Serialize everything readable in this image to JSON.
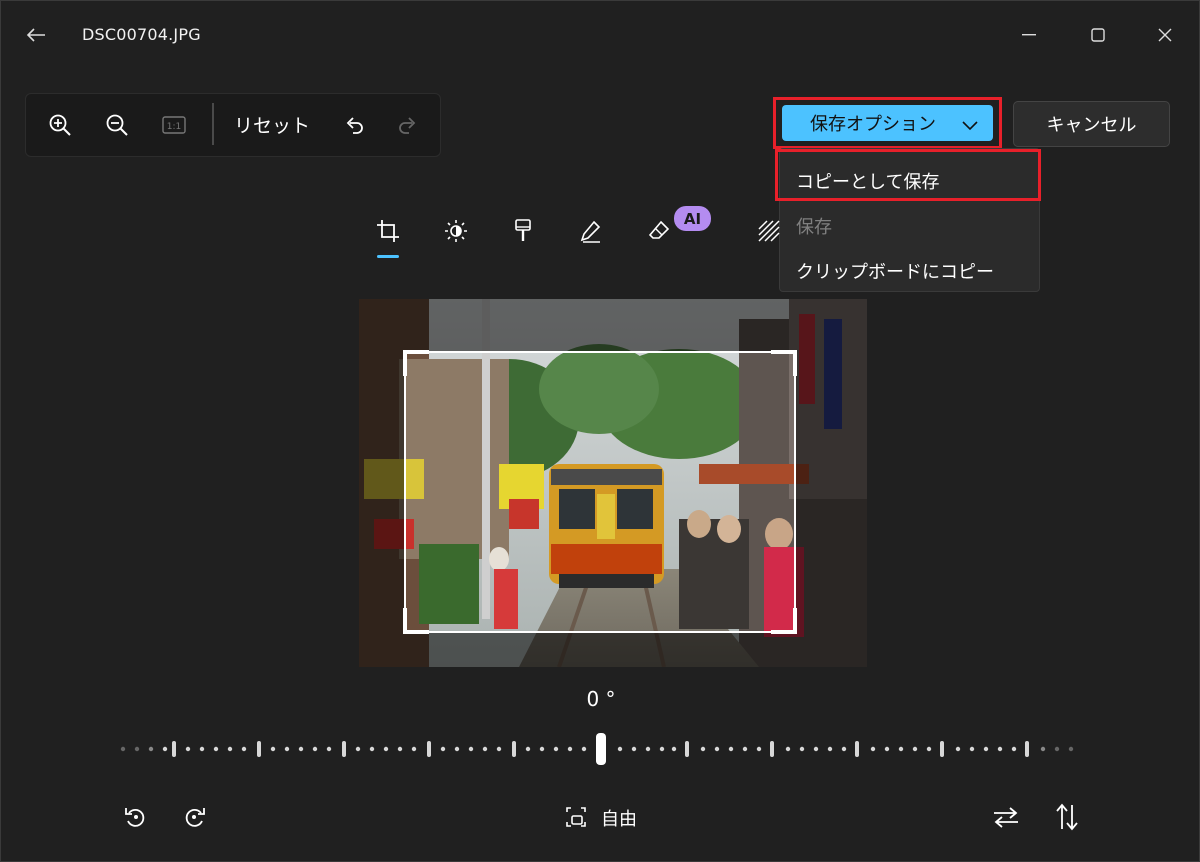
{
  "window": {
    "title": "DSC00704.JPG"
  },
  "toolbar": {
    "reset_label": "リセット"
  },
  "save": {
    "label": "保存オプション",
    "cancel_label": "キャンセル"
  },
  "menu": {
    "items": [
      {
        "label": "コピーとして保存",
        "enabled": true
      },
      {
        "label": "保存",
        "enabled": false
      },
      {
        "label": "クリップボードにコピー",
        "enabled": true
      }
    ]
  },
  "tabs": {
    "ai_badge": "AI"
  },
  "rotation": {
    "angle_label": "0 °",
    "angle_value": 0
  },
  "aspect": {
    "label": "自由"
  },
  "colors": {
    "accent": "#4cc2ff",
    "highlight": "#e8202a",
    "ai_badge": "#b48cf0",
    "background": "#202020"
  }
}
